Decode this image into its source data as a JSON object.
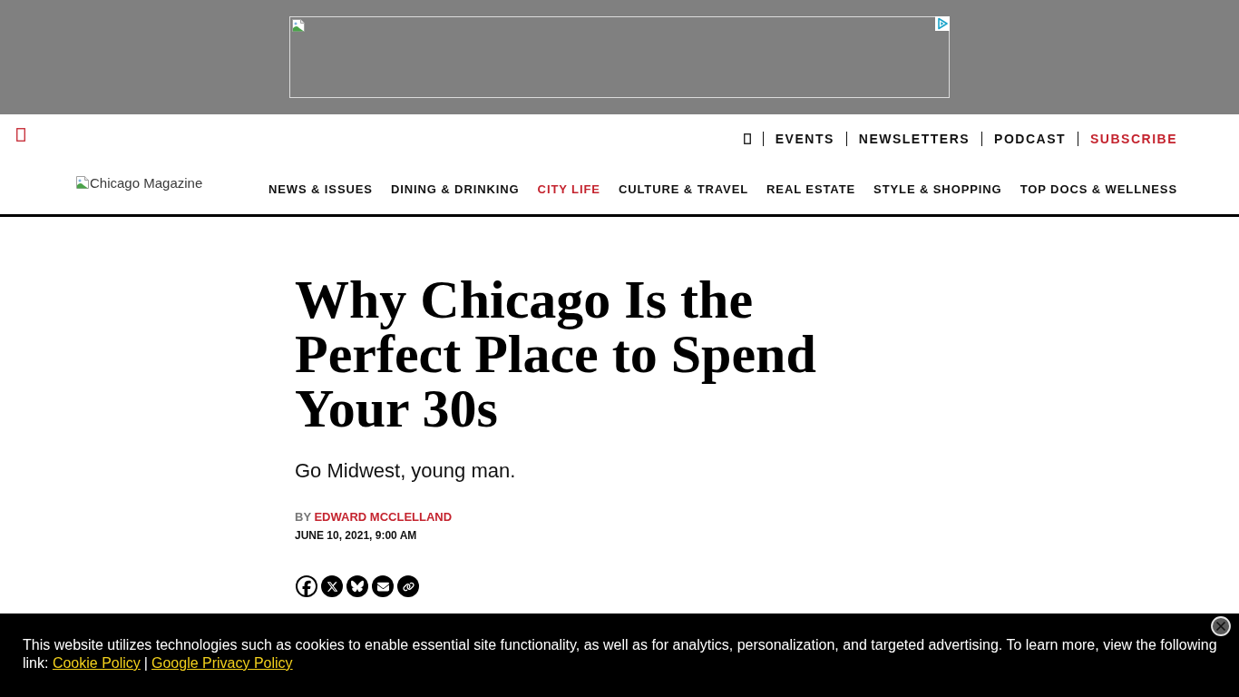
{
  "header": {
    "utility_links": [
      {
        "label": "EVENTS",
        "kind": "link"
      },
      {
        "label": "NEWSLETTERS",
        "kind": "link"
      },
      {
        "label": "PODCAST",
        "kind": "link"
      },
      {
        "label": "SUBSCRIBE",
        "kind": "cta"
      }
    ],
    "logo_alt": "Chicago Magazine",
    "nav": [
      {
        "label": "NEWS & ISSUES",
        "selected": false
      },
      {
        "label": "DINING & DRINKING",
        "selected": false
      },
      {
        "label": "CITY LIFE",
        "selected": true
      },
      {
        "label": "CULTURE & TRAVEL",
        "selected": false
      },
      {
        "label": "REAL ESTATE",
        "selected": false
      },
      {
        "label": "STYLE & SHOPPING",
        "selected": false
      },
      {
        "label": "TOP DOCS & WELLNESS",
        "selected": false
      }
    ]
  },
  "article": {
    "title": "Why Chicago Is the Perfect Place to Spend Your 30s",
    "subtitle": "Go Midwest, young man.",
    "byline_prefix": "BY",
    "author": "EDWARD MCCLELLAND",
    "date": "JUNE 10, 2021, 9:00 AM"
  },
  "cookie_banner": {
    "text": "This website utilizes technologies such as cookies to enable essential site functionality, as well as for analytics, personalization, and targeted advertising. To learn more, view the following link:",
    "links": [
      "Cookie Policy",
      "Google Privacy Policy"
    ],
    "separator": "|"
  }
}
